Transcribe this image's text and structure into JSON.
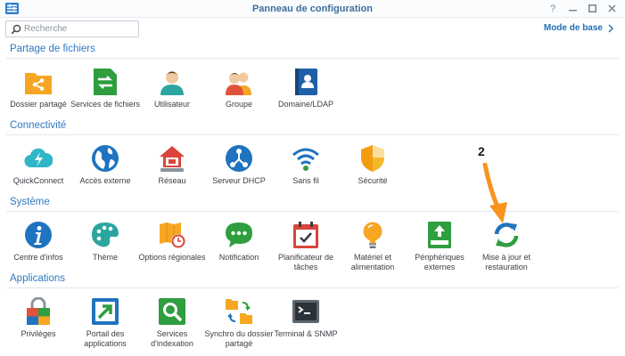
{
  "window": {
    "title": "Panneau de configuration",
    "controls": {
      "help": "?",
      "minimize": "—",
      "maximize": "□",
      "close": "✕"
    }
  },
  "search": {
    "placeholder": "Recherche",
    "value": ""
  },
  "mode_button": {
    "label": "Mode de base"
  },
  "sections": [
    {
      "title": "Partage de fichiers",
      "items": [
        {
          "label": "Dossier partagé",
          "icon": "shared-folder-icon",
          "color": "#f6a623"
        },
        {
          "label": "Services de fichiers",
          "icon": "file-services-icon",
          "color": "#2e9e3f"
        },
        {
          "label": "Utilisateur",
          "icon": "user-icon",
          "color": "#2aa5a0"
        },
        {
          "label": "Groupe",
          "icon": "group-icon",
          "color": "#e0533a"
        },
        {
          "label": "Domaine/LDAP",
          "icon": "domain-ldap-icon",
          "color": "#1d5fa8"
        }
      ]
    },
    {
      "title": "Connectivité",
      "items": [
        {
          "label": "QuickConnect",
          "icon": "quickconnect-icon",
          "color": "#2fb7c8"
        },
        {
          "label": "Accès externe",
          "icon": "external-access-icon",
          "color": "#1f73bf"
        },
        {
          "label": "Réseau",
          "icon": "network-icon",
          "color": "#d9453b"
        },
        {
          "label": "Serveur DHCP",
          "icon": "dhcp-server-icon",
          "color": "#1f73bf"
        },
        {
          "label": "Sans fil",
          "icon": "wireless-icon",
          "color": "#2e9e3f"
        },
        {
          "label": "Sécurité",
          "icon": "security-icon",
          "color": "#f5b82b"
        }
      ]
    },
    {
      "title": "Système",
      "items": [
        {
          "label": "Centre d'infos",
          "icon": "info-center-icon",
          "color": "#1f73bf"
        },
        {
          "label": "Thème",
          "icon": "theme-icon",
          "color": "#2aa5a0"
        },
        {
          "label": "Options régionales",
          "icon": "regional-options-icon",
          "color": "#f6a623"
        },
        {
          "label": "Notification",
          "icon": "notification-icon",
          "color": "#2e9e3f"
        },
        {
          "label": "Planificateur de tâches",
          "icon": "task-scheduler-icon",
          "color": "#d9453b"
        },
        {
          "label": "Matériel et alimentation",
          "icon": "hardware-power-icon",
          "color": "#f6a623"
        },
        {
          "label": "Périphériques externes",
          "icon": "external-devices-icon",
          "color": "#2e9e3f"
        },
        {
          "label": "Mise à jour et restauration",
          "icon": "update-restore-icon",
          "color": "#1f73bf"
        }
      ]
    },
    {
      "title": "Applications",
      "items": [
        {
          "label": "Privilèges",
          "icon": "privileges-icon",
          "color": "#e0533a"
        },
        {
          "label": "Portail des applications",
          "icon": "application-portal-icon",
          "color": "#1f73bf"
        },
        {
          "label": "Services d'indexation",
          "icon": "indexing-service-icon",
          "color": "#2e9e3f"
        },
        {
          "label": "Synchro du dossier partagé",
          "icon": "shared-folder-sync-icon",
          "color": "#f6a623"
        },
        {
          "label": "Terminal & SNMP",
          "icon": "terminal-snmp-icon",
          "color": "#3c4650"
        }
      ]
    }
  ],
  "annotation": {
    "number": "2",
    "arrow_color": "#f7941d"
  }
}
